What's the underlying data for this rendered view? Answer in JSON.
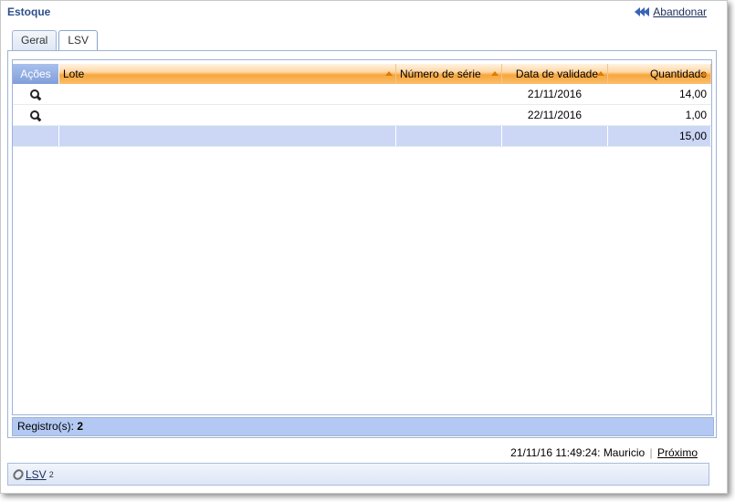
{
  "header": {
    "title": "Estoque",
    "abandon_label": "Abandonar",
    "abandon_icon": "rewind-icon"
  },
  "tabs": [
    {
      "label": "Geral",
      "active": false
    },
    {
      "label": "LSV",
      "active": true
    }
  ],
  "grid": {
    "columns": [
      "Ações",
      "Lote",
      "Número de série",
      "Data de validade",
      "Quantidade"
    ],
    "rows": [
      {
        "acao_icon": "magnifier-icon",
        "lote": "",
        "numero_serie": "",
        "data_validade": "21/11/2016",
        "quantidade": "14,00"
      },
      {
        "acao_icon": "magnifier-icon",
        "lote": "",
        "numero_serie": "",
        "data_validade": "22/11/2016",
        "quantidade": "1,00"
      }
    ],
    "total": {
      "quantidade": "15,00"
    },
    "footer": {
      "label": "Registro(s):",
      "count": "2"
    }
  },
  "status": {
    "text": "21/11/16 11:49:24: Mauricio",
    "link": "Próximo"
  },
  "bottom": {
    "label": "LSV",
    "sup": "2",
    "icon": "paperclip-icon"
  },
  "colors": {
    "header_orange": "#f7a63c",
    "acoes_blue": "#7f9fda",
    "footer_blue": "#b3c9f3",
    "title_blue": "#2e4f8a"
  }
}
